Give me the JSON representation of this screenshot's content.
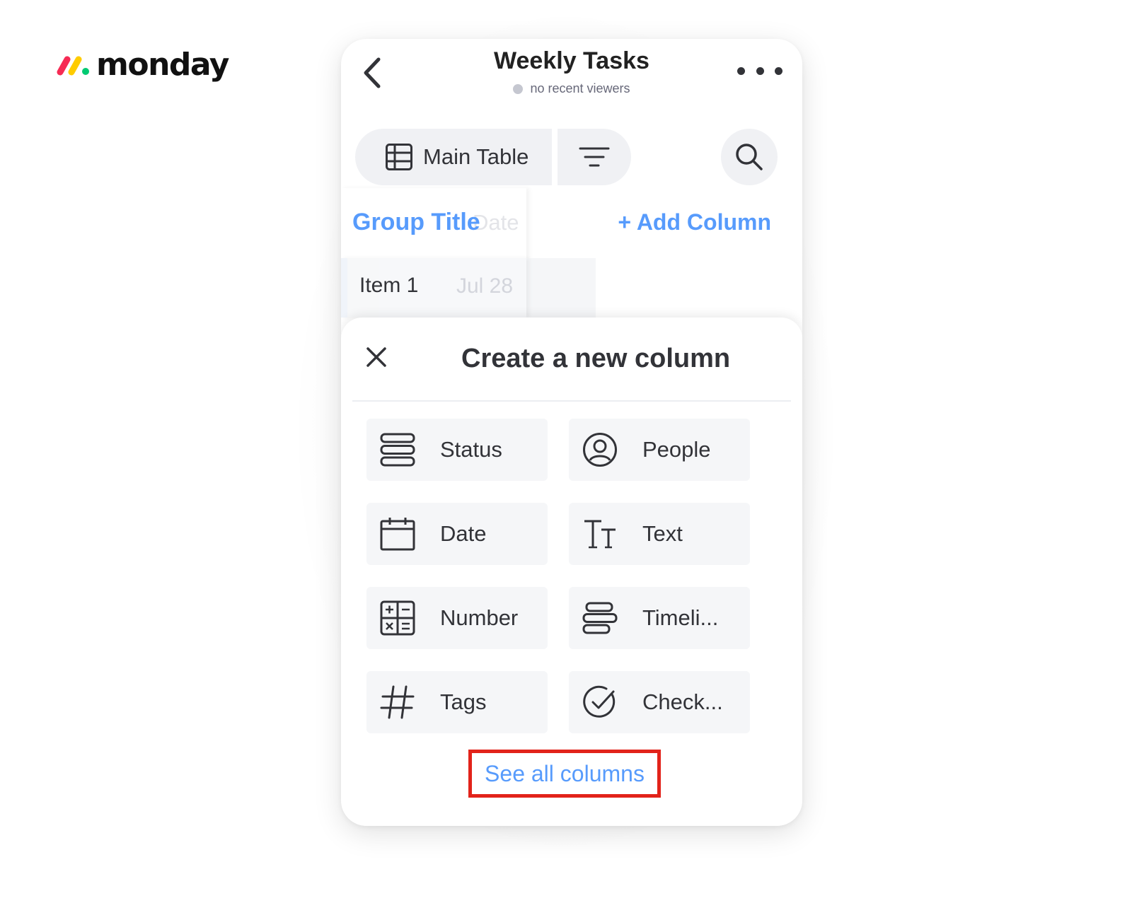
{
  "brand": {
    "logo_text": "monday",
    "colors": {
      "red": "#f62b54",
      "yellow": "#ffcc00",
      "green": "#00ca72"
    }
  },
  "header": {
    "title": "Weekly Tasks",
    "viewers": "no recent viewers",
    "back_icon": "chevron-left-icon",
    "more_icon": "more-dots-icon"
  },
  "toolbar": {
    "view_label": "Main Table",
    "view_icon": "table-icon",
    "filter_icon": "filter-icon",
    "search_icon": "search-icon"
  },
  "board": {
    "group_title": "Group Title",
    "ghost_column": "Date",
    "add_column": "+ Add Column",
    "rows": [
      {
        "name": "Item 1",
        "date": "Jul 28"
      }
    ]
  },
  "sheet": {
    "title": "Create a new column",
    "close_icon": "close-icon",
    "types": [
      {
        "label": "Status",
        "icon": "status-icon"
      },
      {
        "label": "People",
        "icon": "person-icon"
      },
      {
        "label": "Date",
        "icon": "calendar-icon"
      },
      {
        "label": "Text",
        "icon": "text-icon"
      },
      {
        "label": "Number",
        "icon": "numbers-icon"
      },
      {
        "label": "Timeli...",
        "icon": "timeline-icon"
      },
      {
        "label": "Tags",
        "icon": "hashtag-icon"
      },
      {
        "label": "Check...",
        "icon": "checkmark-icon"
      }
    ],
    "see_all": "See all columns",
    "highlight_color": "#e2231a",
    "link_color": "#579bfc"
  }
}
